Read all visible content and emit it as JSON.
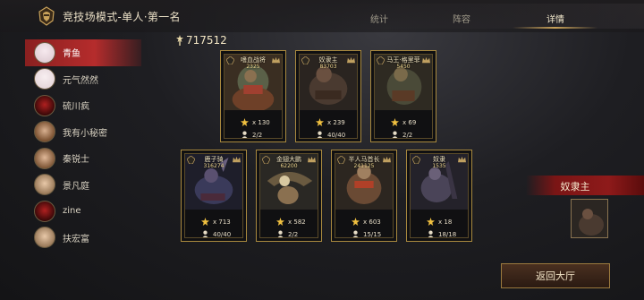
{
  "header": {
    "title": "竞技场模式-单人·第一名",
    "tabs": [
      {
        "label": "统计",
        "active": false
      },
      {
        "label": "阵容",
        "active": false
      },
      {
        "label": "详情",
        "active": true
      }
    ]
  },
  "sidebar": {
    "players": [
      {
        "name": "青鱼",
        "selected": true
      },
      {
        "name": "元气然然",
        "selected": false
      },
      {
        "name": "硫川疯",
        "selected": false
      },
      {
        "name": "我有小秘密",
        "selected": false
      },
      {
        "name": "秦锐士",
        "selected": false
      },
      {
        "name": "景凡庭",
        "selected": false
      },
      {
        "name": "zine",
        "selected": false
      },
      {
        "name": "扶宏富",
        "selected": false
      }
    ]
  },
  "total_power": "717512",
  "cards": [
    {
      "name": "嗜血战将",
      "power": "2325",
      "stars": "x 130",
      "count": "2/2"
    },
    {
      "name": "奴隶主",
      "power": "83703",
      "stars": "x 239",
      "count": "40/40"
    },
    {
      "name": "马王·格里菲",
      "power": "5450",
      "stars": "x 69",
      "count": "2/2"
    },
    {
      "name": "鹿子骑",
      "power": "316274",
      "stars": "x 713",
      "count": "40/40"
    },
    {
      "name": "金翅大鹏",
      "power": "62200",
      "stars": "x 582",
      "count": "2/2"
    },
    {
      "name": "半人马首长",
      "power": "241125",
      "stars": "x 603",
      "count": "15/15"
    },
    {
      "name": "奴隶",
      "power": "1535",
      "stars": "x 18",
      "count": "18/18"
    }
  ],
  "right_panel": {
    "banner_label": "奴隶主"
  },
  "footer": {
    "back_label": "返回大厅"
  },
  "colors": {
    "accent_gold": "#a9893e",
    "selected_red": "#b52c2c",
    "banner_red": "#8e1a1a"
  }
}
